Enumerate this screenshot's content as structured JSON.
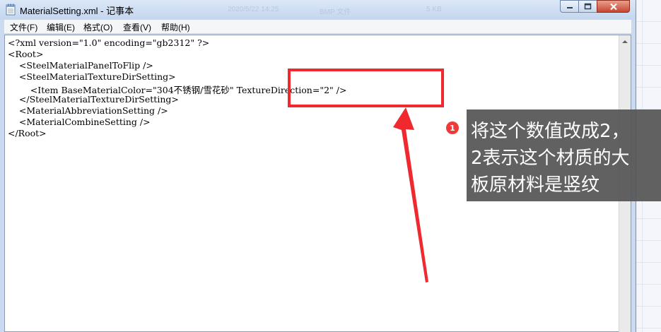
{
  "window": {
    "title": "MaterialSetting.xml - 记事本",
    "ghost_text": [
      "2020/5/22 14:25",
      "BMP 文件",
      "5 KB"
    ]
  },
  "menu": [
    {
      "label": "文件(F)"
    },
    {
      "label": "编辑(E)"
    },
    {
      "label": "格式(O)"
    },
    {
      "label": "查看(V)"
    },
    {
      "label": "帮助(H)"
    }
  ],
  "editor": {
    "lines": [
      "<?xml version=\"1.0\" encoding=\"gb2312\" ?>",
      "<Root>",
      "    <SteelMaterialPanelToFlip />",
      "    <SteelMaterialTextureDirSetting>",
      "        <Item BaseMaterialColor=\"304不锈钢/雪花砂\" TextureDirection=\"2\" />",
      "    </SteelMaterialTextureDirSetting>",
      "    <MaterialAbbreviationSetting />",
      "    <MaterialCombineSetting />",
      "</Root>"
    ]
  },
  "annotation": {
    "badge_number": "1",
    "callout_lines": [
      "将这个数值改成2，",
      "2表示这个材质的大",
      "板原材料是竖纹"
    ],
    "highlight_color": "#f0292f",
    "arrow_color": "#f0292f"
  },
  "icons": {
    "app": "notepad-icon",
    "minimize": "minimize-icon",
    "maximize": "maximize-icon",
    "close": "close-icon",
    "scroll_up": "scroll-up-arrow-icon"
  }
}
